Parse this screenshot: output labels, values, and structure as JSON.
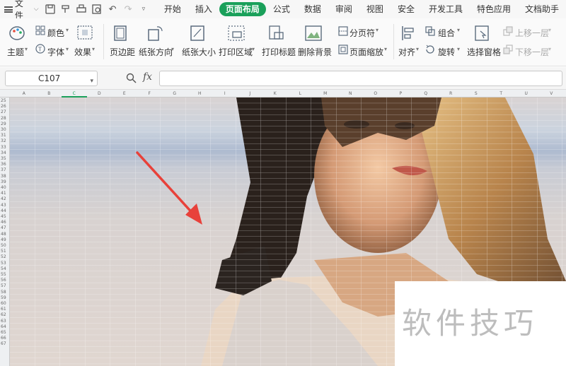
{
  "menu": {
    "file_label": "文件",
    "tabs": [
      {
        "label": "开始"
      },
      {
        "label": "插入"
      },
      {
        "label": "页面布局"
      },
      {
        "label": "公式"
      },
      {
        "label": "数据"
      },
      {
        "label": "审阅"
      },
      {
        "label": "视图"
      },
      {
        "label": "安全"
      },
      {
        "label": "开发工具"
      },
      {
        "label": "特色应用"
      },
      {
        "label": "文档助手"
      }
    ],
    "active_tab": "页面布局"
  },
  "ribbon": {
    "theme": "主题",
    "colors": "颜色",
    "fonts": "字体",
    "effects": "效果",
    "margins": "页边距",
    "orientation": "纸张方向",
    "size": "纸张大小",
    "print_area": "打印区域",
    "print_titles": "打印标题",
    "delete_background": "删除背景",
    "breaks": "分页符",
    "page_zoom": "页面缩放",
    "align": "对齐",
    "group": "组合",
    "rotate": "旋转",
    "selection_pane": "选择窗格",
    "bring_forward": "上移一层",
    "send_backward": "下移一层"
  },
  "formula_bar": {
    "cell_ref": "C107",
    "fx_label": "fx",
    "formula": ""
  },
  "sheet": {
    "columns": [
      "A",
      "B",
      "C",
      "D",
      "E",
      "F",
      "G",
      "H",
      "I",
      "J",
      "K",
      "L",
      "M",
      "N",
      "O",
      "P",
      "Q",
      "R",
      "S",
      "T",
      "U",
      "V"
    ],
    "rows": [
      "25",
      "26",
      "27",
      "28",
      "29",
      "30",
      "31",
      "32",
      "33",
      "34",
      "35",
      "36",
      "37",
      "38",
      "39",
      "40",
      "41",
      "42",
      "43",
      "44",
      "45",
      "46",
      "47",
      "48",
      "49",
      "50",
      "51",
      "52",
      "53",
      "54",
      "55",
      "56",
      "57",
      "58",
      "59",
      "60",
      "61",
      "62",
      "63",
      "64",
      "65",
      "66",
      "67"
    ]
  },
  "watermark": "软件技巧",
  "colors": {
    "accent": "#1aa05a",
    "arrow": "#e8413a"
  }
}
